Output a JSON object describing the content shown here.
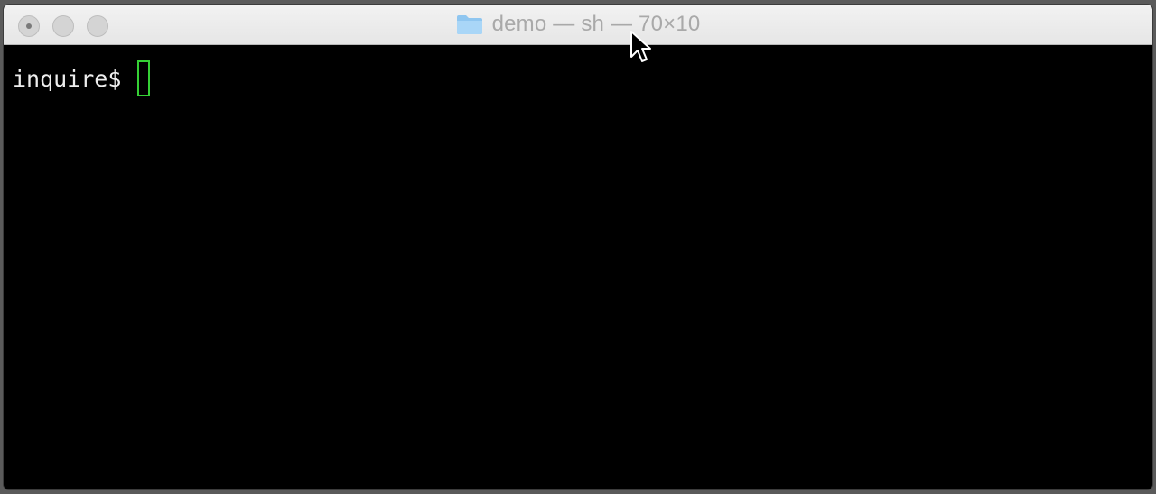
{
  "window": {
    "title": "demo — sh — 70×10"
  },
  "icons": {
    "folder": "folder-icon",
    "pointer": "mouse-pointer-icon"
  },
  "terminal": {
    "prompt": "inquire$",
    "cursor_color": "#35d035"
  }
}
